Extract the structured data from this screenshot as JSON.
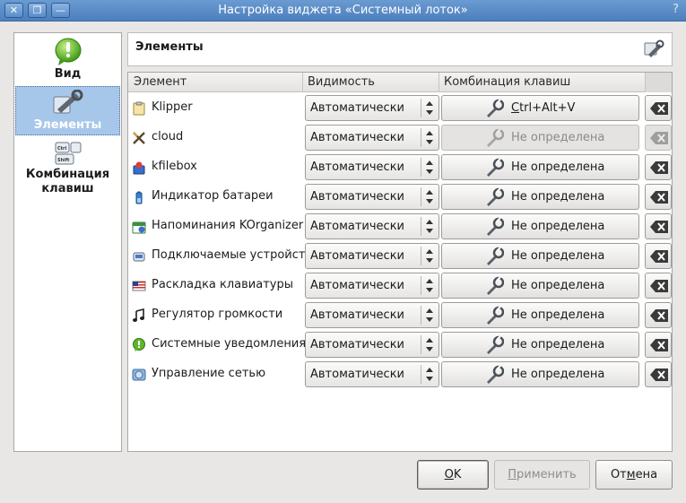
{
  "window": {
    "title": "Настройка виджета «Системный лоток»",
    "help_glyph": "?",
    "buttons": {
      "close": "✕",
      "restore": "❐",
      "minimize": "—"
    }
  },
  "nav": {
    "items": [
      {
        "label": "Вид",
        "icon": "bubble-exclamation-icon",
        "selected": false
      },
      {
        "label": "Элементы",
        "icon": "wrench-icon",
        "selected": true
      },
      {
        "label": "Комбинация клавиш",
        "icon": "keyboard-icon",
        "selected": false
      }
    ]
  },
  "panel": {
    "title": "Элементы",
    "header_icon": "configure-icon"
  },
  "table": {
    "columns": [
      "Элемент",
      "Видимость",
      "Комбинация клавиш"
    ],
    "rows": [
      {
        "name": "Klipper",
        "icon": "clipboard-icon",
        "visibility": "Автоматически",
        "shortcut_prefix": "",
        "shortcut_underline": "C",
        "shortcut_rest": "trl+Alt+V",
        "enabled": true
      },
      {
        "name": "cloud",
        "icon": "cloud-tools-icon",
        "visibility": "Автоматически",
        "shortcut_prefix": "Не определена",
        "shortcut_underline": "",
        "shortcut_rest": "",
        "enabled": false
      },
      {
        "name": "kfilebox",
        "icon": "filebox-icon",
        "visibility": "Автоматически",
        "shortcut_prefix": "Не определена",
        "shortcut_underline": "",
        "shortcut_rest": "",
        "enabled": true
      },
      {
        "name": "Индикатор батареи",
        "icon": "battery-icon",
        "visibility": "Автоматически",
        "shortcut_prefix": "Не определена",
        "shortcut_underline": "",
        "shortcut_rest": "",
        "enabled": true
      },
      {
        "name": "Напоминания KOrganizer",
        "icon": "calendar-alarm-icon",
        "visibility": "Автоматически",
        "shortcut_prefix": "Не определена",
        "shortcut_underline": "",
        "shortcut_rest": "",
        "enabled": true
      },
      {
        "name": "Подключаемые устройства",
        "icon": "device-icon",
        "visibility": "Автоматически",
        "shortcut_prefix": "Не определена",
        "shortcut_underline": "",
        "shortcut_rest": "",
        "enabled": true
      },
      {
        "name": "Раскладка клавиатуры",
        "icon": "flag-us-icon",
        "visibility": "Автоматически",
        "shortcut_prefix": "Не определена",
        "shortcut_underline": "",
        "shortcut_rest": "",
        "enabled": true
      },
      {
        "name": "Регулятор громкости",
        "icon": "music-note-icon",
        "visibility": "Автоматически",
        "shortcut_prefix": "Не определена",
        "shortcut_underline": "",
        "shortcut_rest": "",
        "enabled": true
      },
      {
        "name": "Системные уведомления",
        "icon": "notification-icon",
        "visibility": "Автоматически",
        "shortcut_prefix": "Не определена",
        "shortcut_underline": "",
        "shortcut_rest": "",
        "enabled": true
      },
      {
        "name": "Управление сетью",
        "icon": "network-icon",
        "visibility": "Автоматически",
        "shortcut_prefix": "Не определена",
        "shortcut_underline": "",
        "shortcut_rest": "",
        "enabled": true
      }
    ]
  },
  "footer": {
    "ok": {
      "underline": "O",
      "rest": "K"
    },
    "apply": {
      "underline": "П",
      "rest": "рименить"
    },
    "cancel": {
      "prefix": "От",
      "underline": "м",
      "rest": "ена"
    }
  },
  "colors": {
    "titlebar": "#5a8cc8",
    "selection": "#a6c7ea",
    "window_bg": "#e8e7e6"
  }
}
